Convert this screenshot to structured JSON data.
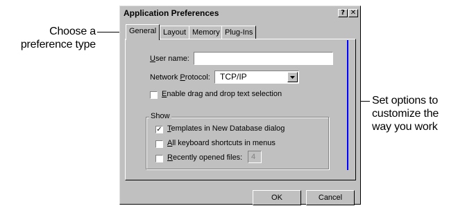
{
  "callouts": {
    "left_line1": "Choose a",
    "left_line2": "preference type",
    "right_line1": "Set options to",
    "right_line2": "customize the",
    "right_line3": "way you work"
  },
  "dialog": {
    "title": "Application Preferences",
    "help_glyph": "?",
    "close_glyph": "✕",
    "tabs": [
      {
        "label": "General",
        "active": true
      },
      {
        "label": "Layout",
        "active": false
      },
      {
        "label": "Memory",
        "active": false
      },
      {
        "label": "Plug-Ins",
        "active": false
      }
    ],
    "user_name": {
      "label_first": "U",
      "label_rest": "ser name:",
      "value": ""
    },
    "network_protocol": {
      "label_before": "Network ",
      "label_underlined": "P",
      "label_after": "rotocol:",
      "selected": "TCP/IP"
    },
    "drag_drop": {
      "first": "E",
      "rest": "nable drag and drop text selection",
      "checked": false
    },
    "show_group": {
      "label": "Show",
      "templates": {
        "first": "T",
        "rest": "emplates in New Database dialog",
        "checked": true
      },
      "keyboard": {
        "first": "A",
        "rest": "ll keyboard shortcuts in menus",
        "checked": false
      },
      "recent": {
        "first": "R",
        "rest": "ecently opened files:",
        "checked": false,
        "count": "4"
      }
    },
    "ok_label": "OK",
    "cancel_label": "Cancel"
  },
  "colors": {
    "dialog_face": "#c0c0c0",
    "callout_line": "#000000",
    "accent_line": "#0000ff"
  }
}
